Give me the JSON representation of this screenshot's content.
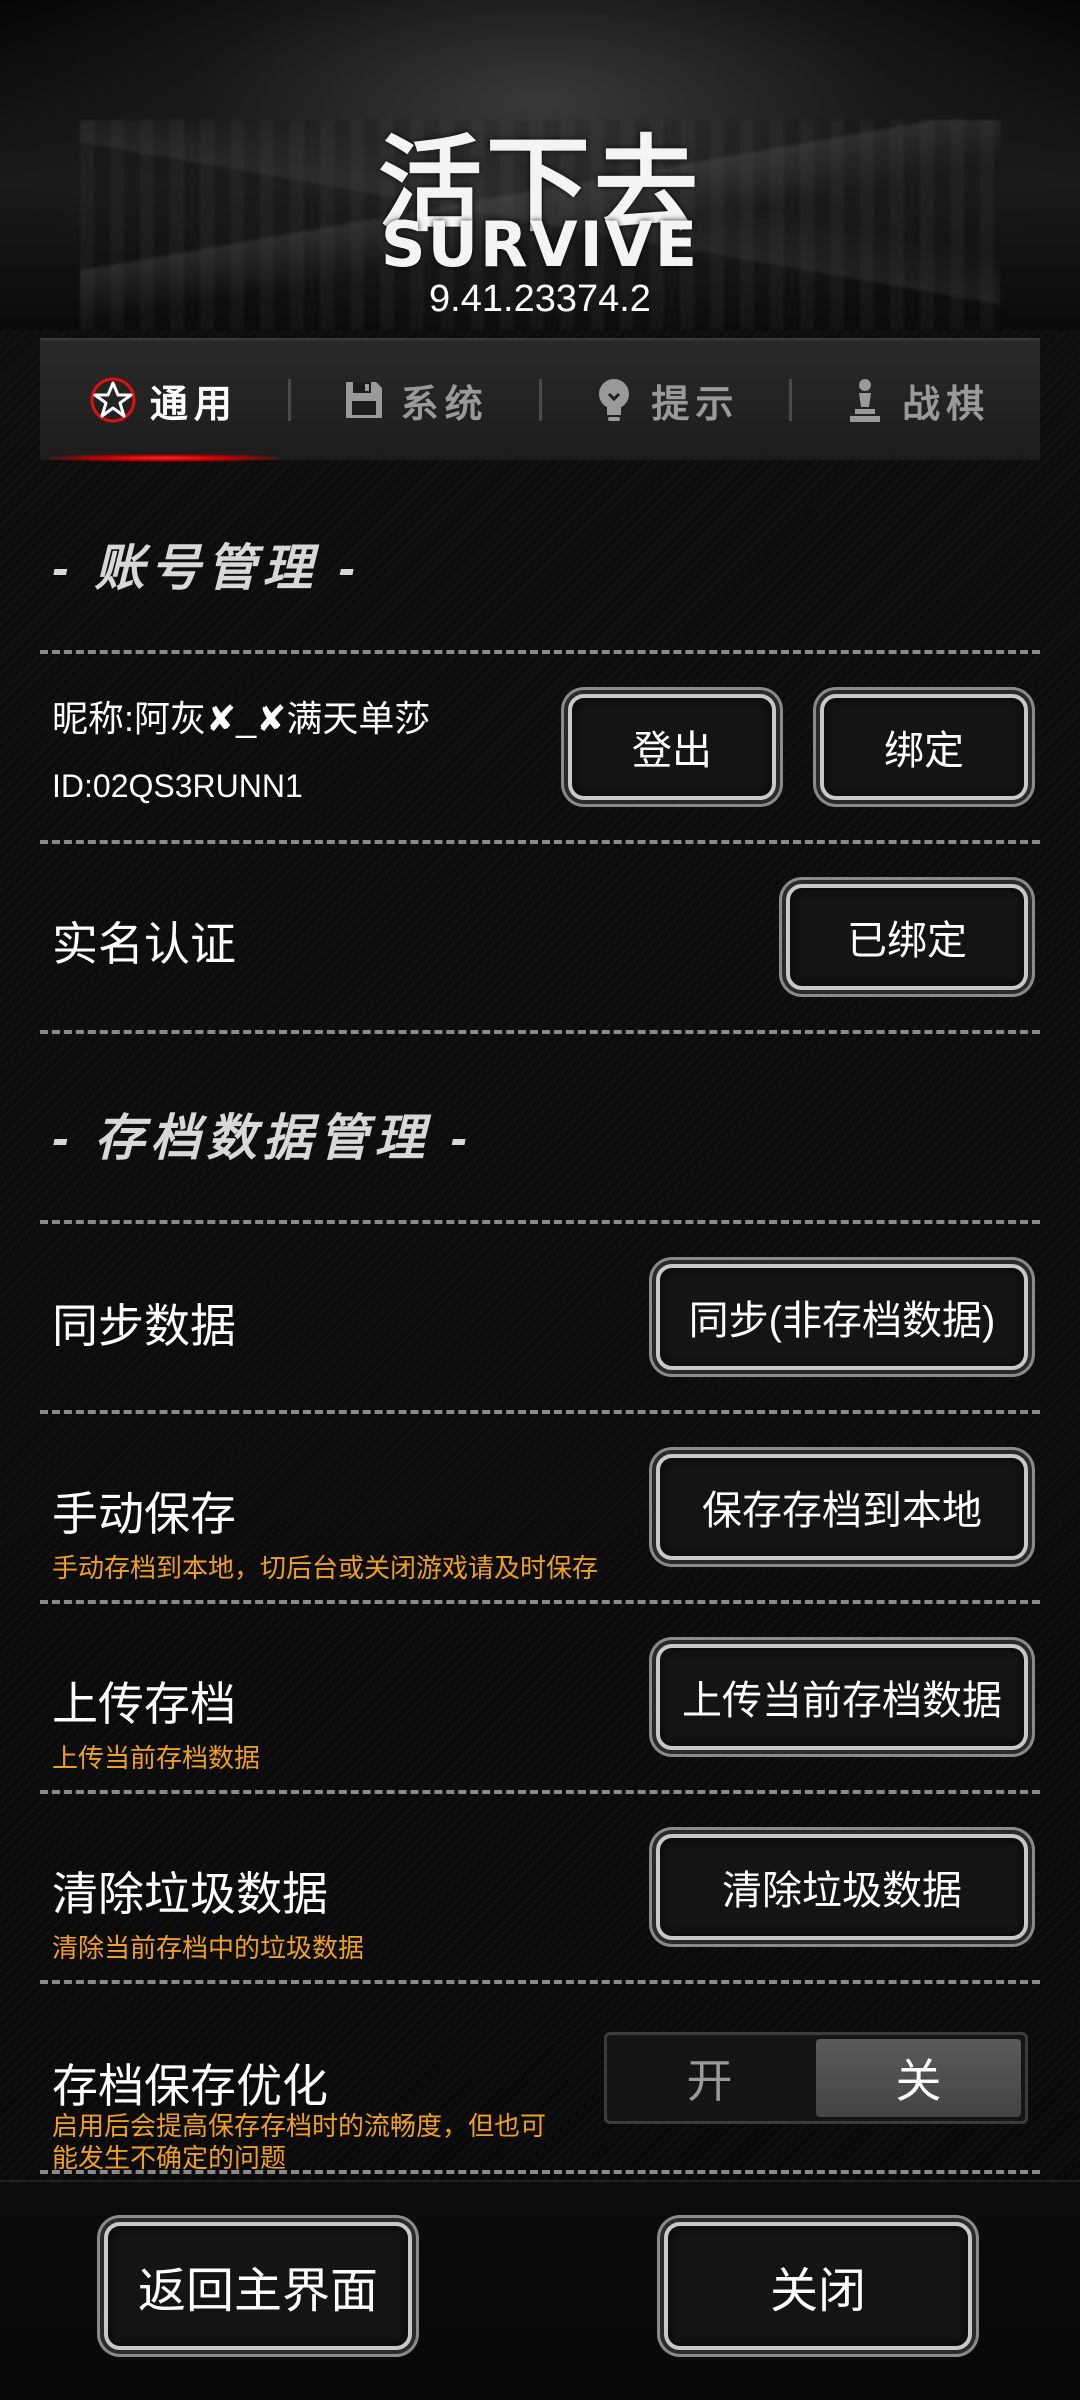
{
  "header": {
    "logo_cn": "活下去",
    "logo_en": "SURVIVE",
    "version": "9.41.23374.2"
  },
  "tabs": [
    {
      "label": "通用",
      "icon": "star-icon",
      "active": true
    },
    {
      "label": "系统",
      "icon": "floppy-disk-icon",
      "active": false
    },
    {
      "label": "提示",
      "icon": "lightbulb-icon",
      "active": false
    },
    {
      "label": "战棋",
      "icon": "chess-pawn-icon",
      "active": false
    }
  ],
  "account": {
    "section_title": "- 账号管理 -",
    "nickname": "昵称:阿灰✘_✘满天单莎",
    "id": "ID:02QS3RUNN1",
    "logout_label": "登出",
    "bind_label": "绑定",
    "realname_label": "实名认证",
    "realname_button": "已绑定"
  },
  "save": {
    "section_title": "- 存档数据管理 -",
    "sync_label": "同步数据",
    "sync_button": "同步(非存档数据)",
    "manual_label": "手动保存",
    "manual_sub": "手动存档到本地，切后台或关闭游戏请及时保存",
    "manual_button": "保存存档到本地",
    "upload_label": "上传存档",
    "upload_sub": "上传当前存档数据",
    "upload_button": "上传当前存档数据",
    "clear_label": "清除垃圾数据",
    "clear_sub": "清除当前存档中的垃圾数据",
    "clear_button": "清除垃圾数据",
    "opt_label": "存档保存优化",
    "opt_sub_line1": "启用后会提高保存存档时的流畅度，但也可",
    "opt_sub_line2": "能发生不确定的问题",
    "toggle_on": "开",
    "toggle_off": "关",
    "toggle_state": "关"
  },
  "footer": {
    "home_button": "返回主界面",
    "close_button": "关闭"
  },
  "colors": {
    "accent_red": "#e01010",
    "hint_orange": "#f0a020",
    "background": "#0b0b0b"
  }
}
